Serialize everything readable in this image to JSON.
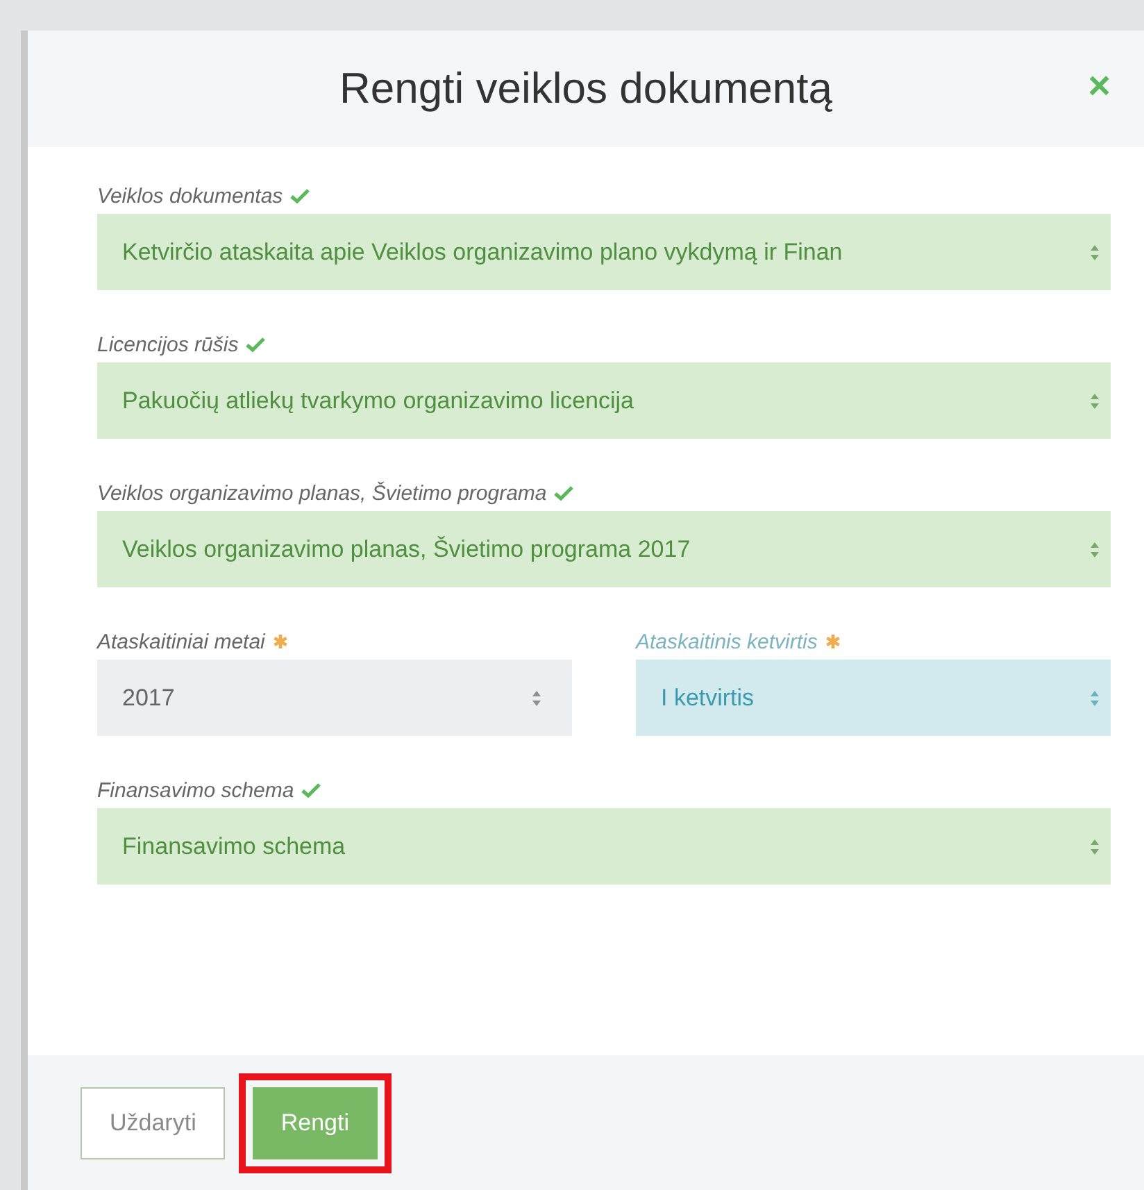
{
  "dialog": {
    "title": "Rengti veiklos dokumentą",
    "close": "×"
  },
  "rows": [
    {
      "fields": [
        {
          "label": "Veiklos dokumentas",
          "kind": "valid",
          "focused": false,
          "value": "Ketvirčio ataskaita apie Veiklos organizavimo plano vykdymą ir Finan"
        }
      ]
    },
    {
      "fields": [
        {
          "label": "Licencijos rūšis",
          "kind": "valid",
          "focused": false,
          "value": "Pakuočių atliekų tvarkymo organizavimo licencija"
        }
      ]
    },
    {
      "fields": [
        {
          "label": "Veiklos organizavimo planas, Švietimo programa",
          "kind": "valid",
          "focused": false,
          "value": "Veiklos organizavimo planas, Švietimo programa 2017"
        }
      ]
    },
    {
      "fields": [
        {
          "label": "Ataskaitiniai metai",
          "kind": "required",
          "focused": false,
          "value": "2017"
        },
        {
          "label": "Ataskaitinis ketvirtis",
          "kind": "required",
          "focused": true,
          "value": "I ketvirtis"
        }
      ]
    },
    {
      "fields": [
        {
          "label": "Finansavimo schema",
          "kind": "valid",
          "focused": false,
          "value": "Finansavimo schema"
        }
      ]
    }
  ],
  "buttons": [
    {
      "label": "Uždaryti",
      "kind": "secondary",
      "highlighted": false
    },
    {
      "label": "Rengti",
      "kind": "primary",
      "highlighted": true
    }
  ]
}
